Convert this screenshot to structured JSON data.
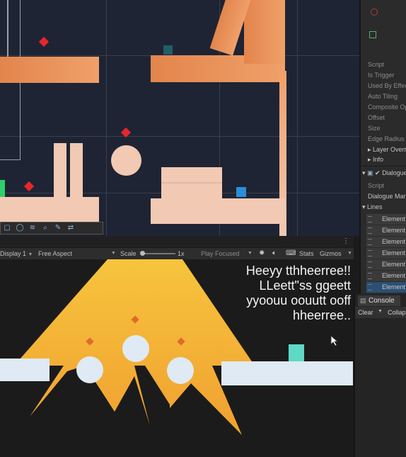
{
  "game_view": {
    "display": "Display 1",
    "aspect": "Free Aspect",
    "scale_label": "Scale",
    "scale_value": "1x",
    "play_mode": "Play Focused",
    "stats": "Stats",
    "gizmos": "Gizmos",
    "dialogue_lines": [
      "Heeyy tthheerree!!",
      "LLeett\"ss ggeett",
      "yyoouu oouutt ooff",
      "hheerree.."
    ]
  },
  "inspector": {
    "properties": [
      "Script",
      "Is Trigger",
      "Used By Effector",
      "Auto Tiling",
      "Composite Operation",
      "Offset",
      "Size",
      "Edge Radius",
      "Layer Overrides",
      "Info"
    ],
    "dialogue_component": "Dialogue",
    "dialogue_fields": [
      "Script",
      "Dialogue Manager"
    ],
    "lines_label": "Lines",
    "elements": [
      "Element",
      "Element",
      "Element",
      "Element",
      "Element",
      "Element",
      "Element"
    ]
  },
  "console": {
    "tab": "Console",
    "clear": "Clear",
    "collapse": "Collapse"
  },
  "colors": {
    "scene_bg": "#1e2434",
    "platform_orange": "#e2854c",
    "platform_peach": "#f2c9b3",
    "hazard_red": "#e8262a",
    "light_cone": "#f5b63a",
    "pickup_teal": "#5ed9c6"
  }
}
